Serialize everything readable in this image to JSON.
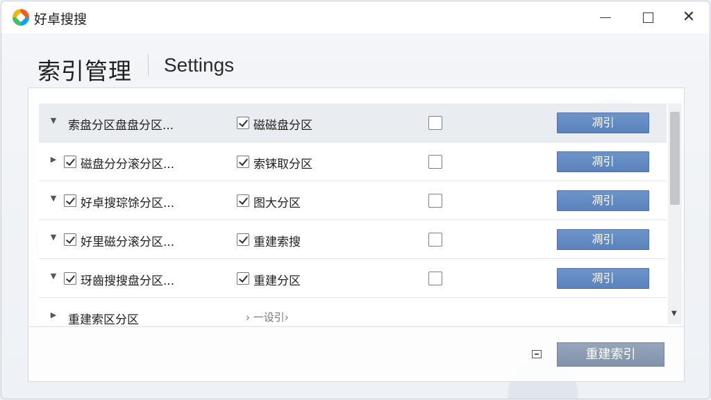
{
  "window": {
    "title": "好卓搜搜",
    "close_glyph": "✕"
  },
  "header": {
    "title": "索引管理",
    "subtitle": "Settings"
  },
  "rows": [
    {
      "expander": "▼",
      "has_left_checkbox": false,
      "left_checked": false,
      "left_label": "索盘分区盘盘分区...",
      "right_checked": true,
      "right_label": "磁磁盘分区",
      "flag_checked": false,
      "button": "凋引",
      "selected": true
    },
    {
      "expander": "▶",
      "has_left_checkbox": true,
      "left_checked": true,
      "left_label": "磁盘分分滚分区...",
      "right_checked": true,
      "right_label": "索铼取分区",
      "flag_checked": false,
      "button": "凋引",
      "selected": false
    },
    {
      "expander": "▼",
      "has_left_checkbox": true,
      "left_checked": true,
      "left_label": "好卓搜琮馀分区...",
      "right_checked": true,
      "right_label": "图大分区",
      "flag_checked": false,
      "button": "凋引",
      "selected": false
    },
    {
      "expander": "▼",
      "has_left_checkbox": true,
      "left_checked": true,
      "left_label": "好里磁分滚分区...",
      "right_checked": true,
      "right_label": "重建索搜",
      "flag_checked": false,
      "button": "凋引",
      "selected": false
    },
    {
      "expander": "▼",
      "has_left_checkbox": true,
      "left_checked": true,
      "left_label": "玡齒搜搜盘分区...",
      "right_checked": true,
      "right_label": "重建分区",
      "flag_checked": false,
      "button": "凋引",
      "selected": false
    },
    {
      "expander": "▶",
      "has_left_checkbox": false,
      "left_checked": false,
      "left_label": "重建索区分区",
      "right_hint": "› 一设引›",
      "selected": false
    }
  ],
  "footer": {
    "rebuild_label": "重建索引"
  },
  "colors": {
    "action_button": "#5c82bb",
    "rebuild_button": "#8192aa",
    "selected_row": "#e9ecf1"
  },
  "icons": {
    "app": "app-logo-icon",
    "minimize": "minimize-icon",
    "maximize": "maximize-icon",
    "close": "close-icon",
    "expander_collapsed": "triangle-right-icon",
    "expander_expanded": "triangle-down-icon",
    "footer_small": "panel-toggle-icon"
  }
}
